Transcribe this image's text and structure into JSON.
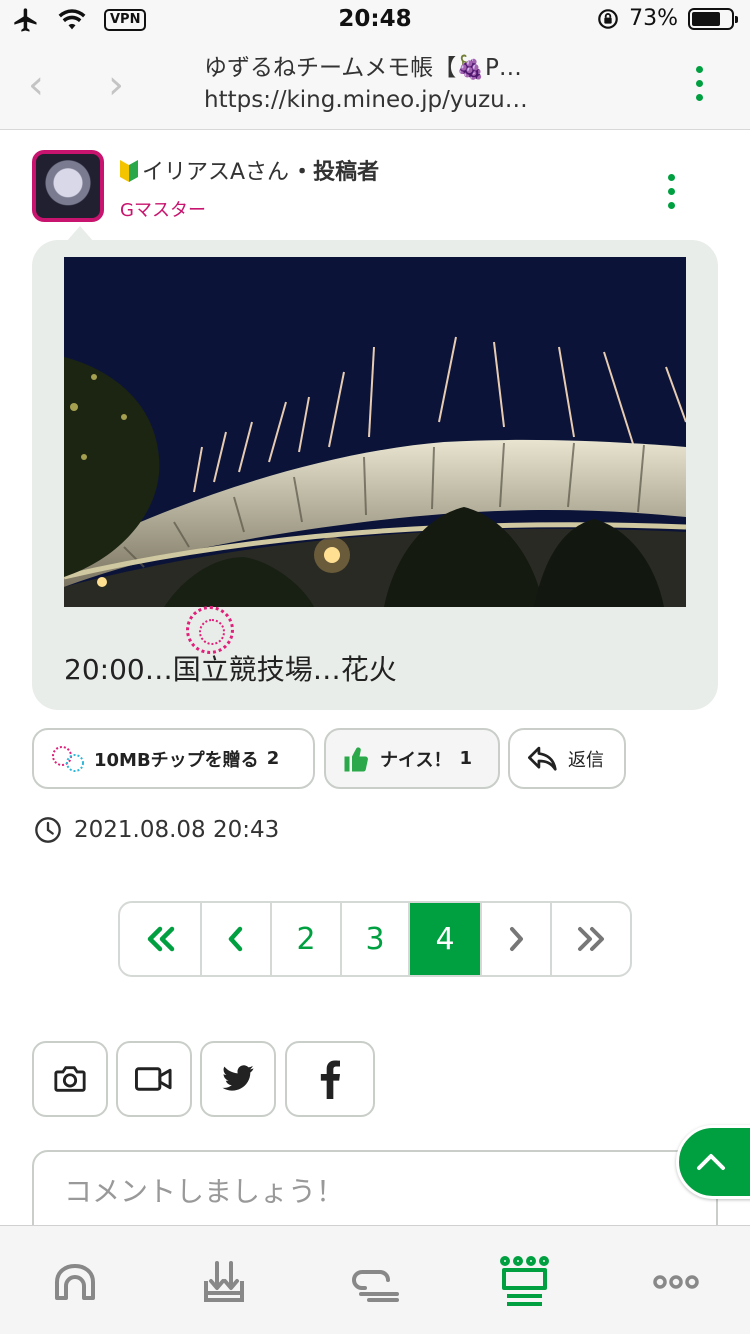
{
  "status_bar": {
    "time": "20:48",
    "vpn": "VPN",
    "battery": "73%",
    "battery_level": 0.73
  },
  "browser": {
    "title": "ゆずるねチームメモ帳【🍇P…",
    "url": "https://king.mineo.jp/yuzu…"
  },
  "post": {
    "author": "イリアスAさん",
    "author_suffix": "・投稿者",
    "rank": "Gマスター",
    "caption": "20:00…国立競技場…花火",
    "tip_label": "10MBチップを贈る",
    "tip_count": "2",
    "nice_label": "ナイス！",
    "nice_count": "1",
    "reply_label": "返信",
    "timestamp": "2021.08.08 20:43"
  },
  "pagination": {
    "pages": [
      "2",
      "3",
      "4"
    ],
    "current": "4"
  },
  "comment": {
    "placeholder": "コメントしましょう！"
  },
  "colors": {
    "accent": "#00a040",
    "brand_pink": "#c8146e",
    "bubble_bg": "#e9ede9"
  },
  "icons": {
    "tab_bar": [
      "home-icon",
      "inbox-icon",
      "board-icon",
      "crown-icon",
      "more-icon"
    ],
    "share": [
      "camera-icon",
      "video-icon",
      "twitter-icon",
      "facebook-icon"
    ]
  }
}
